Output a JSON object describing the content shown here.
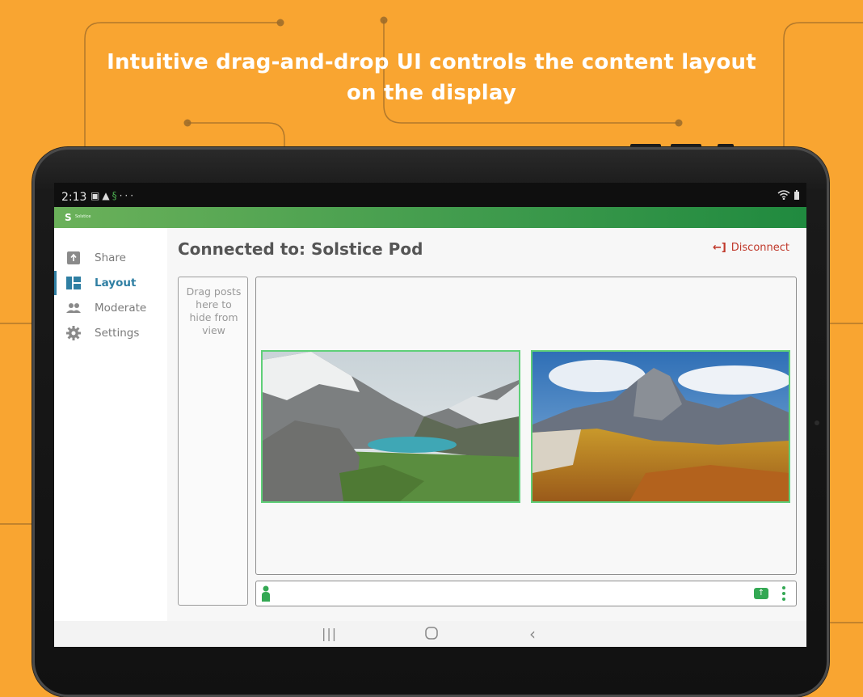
{
  "headline": {
    "line1": "Intuitive drag-and-drop UI controls the content layout",
    "line2": "on the display"
  },
  "colors": {
    "background": "#F9A531",
    "accent_green": "#33A853",
    "nav_active": "#2F7FA3",
    "disconnect_red": "#C0392B"
  },
  "statusbar": {
    "time": "2:13",
    "left_icons": [
      "image-icon",
      "warning-icon",
      "solstice-icon",
      "more-icon"
    ],
    "right_icons": [
      "wifi-icon",
      "battery-icon"
    ]
  },
  "appbar": {
    "brand": "Solstice",
    "logo_icon": "solstice-logo-icon"
  },
  "sidebar": {
    "items": [
      {
        "label": "Share",
        "icon": "share-icon",
        "active": false
      },
      {
        "label": "Layout",
        "icon": "layout-icon",
        "active": true
      },
      {
        "label": "Moderate",
        "icon": "moderate-icon",
        "active": false
      },
      {
        "label": "Settings",
        "icon": "gear-icon",
        "active": false
      }
    ]
  },
  "main": {
    "title": "Connected to: Solstice Pod",
    "disconnect_label": "Disconnect",
    "hide_zone_text": "Drag posts here to hide from view",
    "posts": [
      {
        "name": "mountain-lake-photo"
      },
      {
        "name": "dolomites-photo"
      }
    ]
  },
  "bottombar": {
    "icons": [
      "person-icon",
      "share-screen-icon",
      "more-vertical-icon"
    ]
  },
  "navbar": {
    "buttons": [
      "recent-apps-icon",
      "home-icon",
      "back-icon"
    ]
  }
}
